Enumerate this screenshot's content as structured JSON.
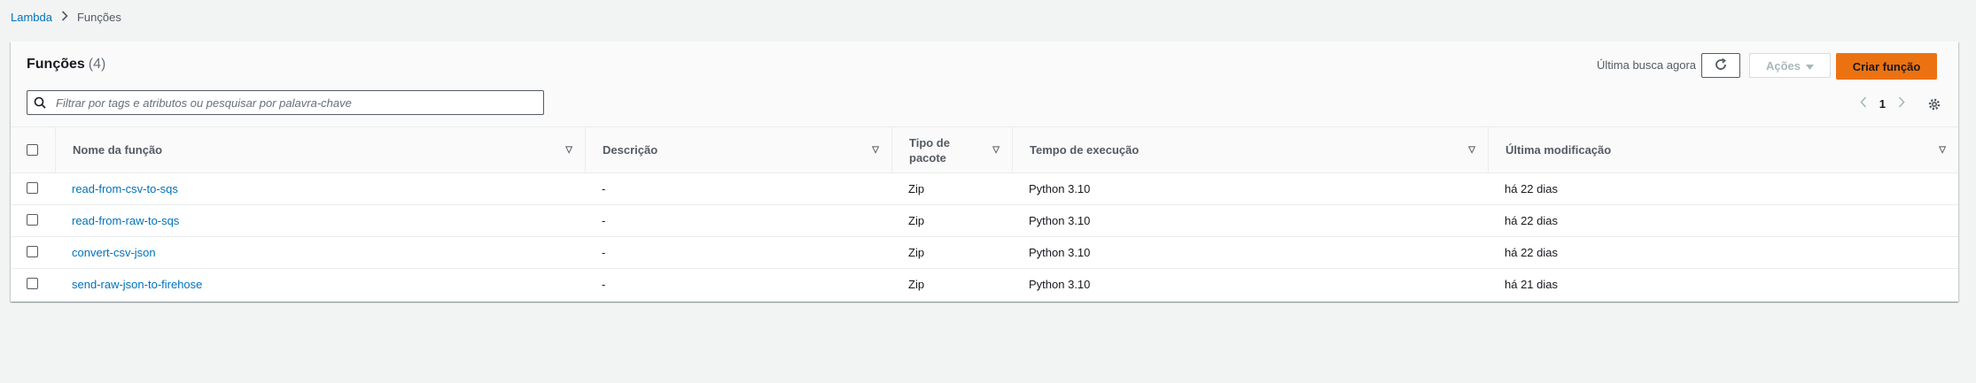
{
  "breadcrumb": {
    "root": "Lambda",
    "current": "Funções"
  },
  "panel": {
    "title": "Funções",
    "count": "(4)",
    "last_fetch": "Última busca agora",
    "actions_label": "Ações",
    "create_label": "Criar função",
    "search_placeholder": "Filtrar por tags e atributos ou pesquisar por palavra-chave",
    "page": "1"
  },
  "table": {
    "columns": [
      "Nome da função",
      "Descrição",
      "Tipo de pacote",
      "Tempo de execução",
      "Última modificação"
    ],
    "rows": [
      {
        "name": "read-from-csv-to-sqs",
        "description": "-",
        "package": "Zip",
        "runtime": "Python 3.10",
        "modified": "há 22 dias"
      },
      {
        "name": "read-from-raw-to-sqs",
        "description": "-",
        "package": "Zip",
        "runtime": "Python 3.10",
        "modified": "há 22 dias"
      },
      {
        "name": "convert-csv-json",
        "description": "-",
        "package": "Zip",
        "runtime": "Python 3.10",
        "modified": "há 22 dias"
      },
      {
        "name": "send-raw-json-to-firehose",
        "description": "-",
        "package": "Zip",
        "runtime": "Python 3.10",
        "modified": "há 21 dias"
      }
    ]
  },
  "colors": {
    "link": "#0073bb",
    "primary": "#ec7211",
    "background": "#f2f3f3"
  },
  "icons": [
    "chevron-right-icon",
    "refresh-icon",
    "caret-down-icon",
    "search-icon",
    "chevron-left-icon",
    "gear-icon",
    "sort-icon"
  ]
}
